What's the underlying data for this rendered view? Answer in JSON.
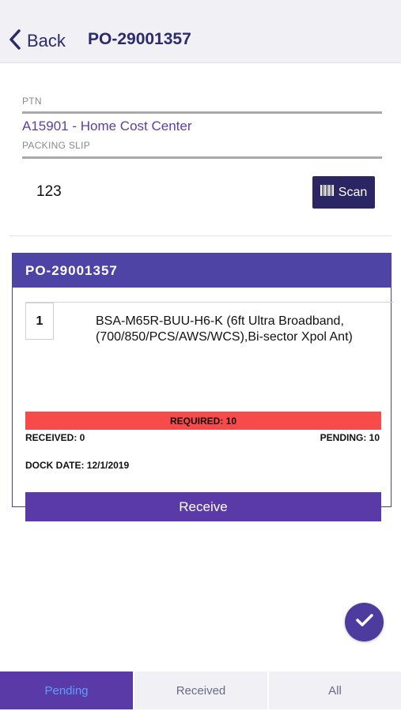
{
  "header": {
    "back_label": "Back",
    "title": "PO-29001357"
  },
  "form": {
    "ptn_label": "PTN",
    "ptn_value": "A15901 - Home Cost Center",
    "packing_slip_label": "PACKING SLIP",
    "packing_slip_value": "123",
    "scan_label": "Scan"
  },
  "card": {
    "title": "PO-29001357",
    "item": {
      "quantity": "1",
      "description": "BSA-M65R-BUU-H6-K (6ft Ultra Broadband, (700/850/PCS/AWS/WCS),Bi-sector Xpol Ant)",
      "required": "REQUIRED: 10",
      "received": "RECEIVED: 0",
      "pending": "PENDING: 10",
      "dock_date": "DOCK DATE: 12/1/2019",
      "receive_label": "Receive"
    }
  },
  "fab": {
    "icon": "checkmark-icon"
  },
  "tabs": [
    {
      "label": "Pending",
      "active": true
    },
    {
      "label": "Received",
      "active": false
    },
    {
      "label": "All",
      "active": false
    }
  ],
  "colors": {
    "brand_dark": "#2b2563",
    "brand_purple": "#5a3aa6",
    "header_purple": "#4e44a6",
    "alert_red": "#f74a4a",
    "link_purple": "#5b3fa3"
  }
}
